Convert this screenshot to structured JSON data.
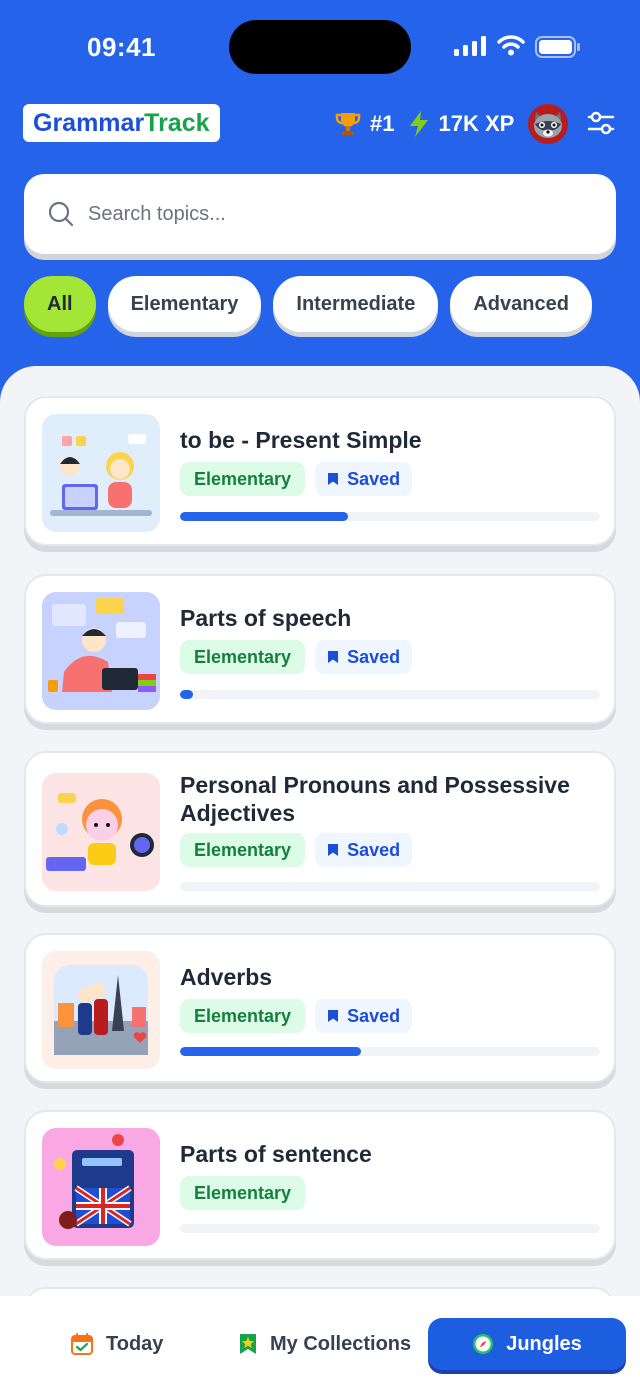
{
  "status": {
    "time": "09:41"
  },
  "header": {
    "logo_part1": "Grammar",
    "logo_part2": "Track",
    "rank": "#1",
    "xp": "17K XP",
    "trophy_icon": "trophy-icon",
    "bolt_icon": "lightning-bolt-icon",
    "filter_icon": "sliders-icon"
  },
  "search": {
    "placeholder": "Search topics...",
    "value": ""
  },
  "filters": [
    {
      "label": "All",
      "active": true
    },
    {
      "label": "Elementary",
      "active": false
    },
    {
      "label": "Intermediate",
      "active": false
    },
    {
      "label": "Advanced",
      "active": false
    }
  ],
  "lessons": [
    {
      "title": "to be - Present Simple",
      "level": "Elementary",
      "saved": "Saved",
      "progress": 0.4
    },
    {
      "title": "Parts of speech",
      "level": "Elementary",
      "saved": "Saved",
      "progress": 0.03
    },
    {
      "title": "Personal Pronouns and Possessive Adjectives",
      "level": "Elementary",
      "saved": "Saved",
      "progress": 0
    },
    {
      "title": "Adverbs",
      "level": "Elementary",
      "saved": "Saved",
      "progress": 0.43
    },
    {
      "title": "Parts of sentence",
      "level": "Elementary",
      "saved": "",
      "progress": 0
    }
  ],
  "nav": {
    "today": "Today",
    "collections": "My Collections",
    "jungles": "Jungles"
  },
  "colors": {
    "primary": "#2563eb",
    "accent_lime": "#a3e635",
    "level_green": "#15803d"
  }
}
